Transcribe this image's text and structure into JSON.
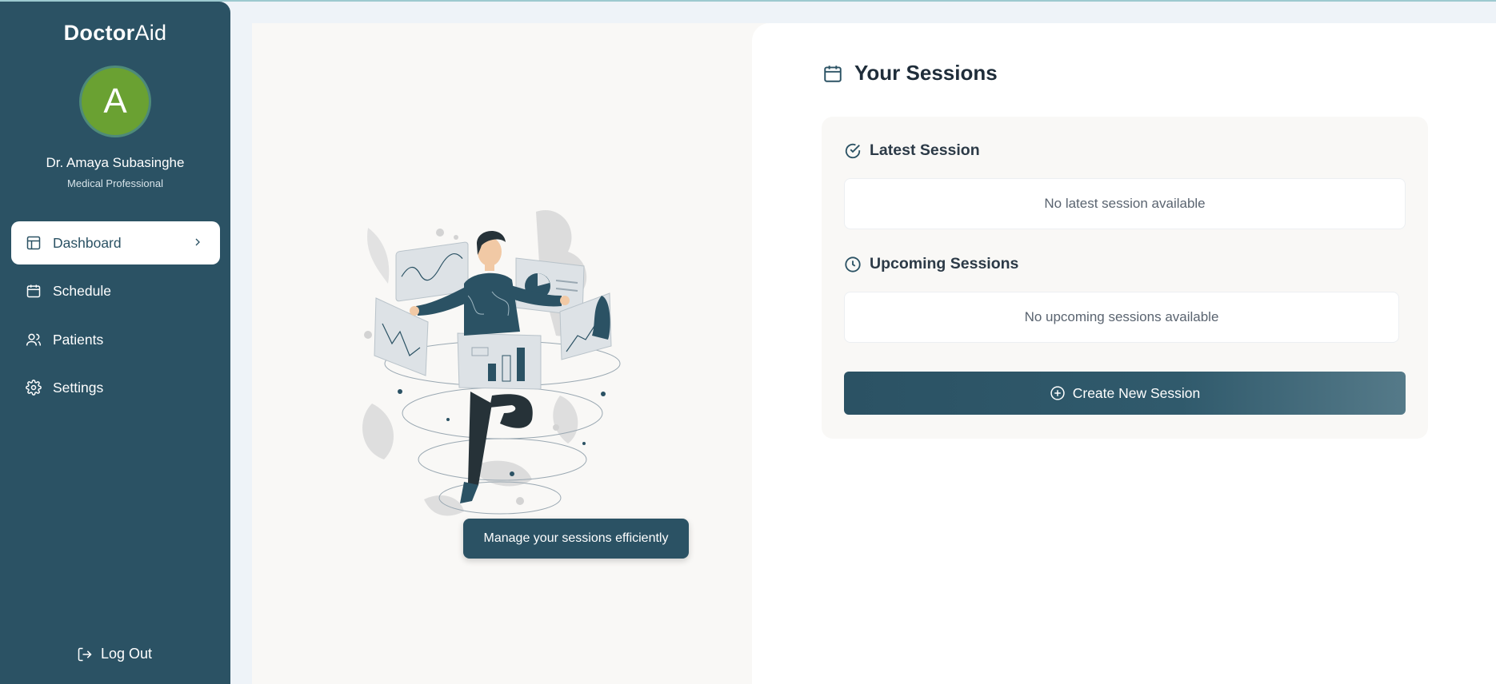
{
  "brand": {
    "logo_bold": "Doctor",
    "logo_light": "Aid"
  },
  "profile": {
    "initial": "A",
    "name": "Dr. Amaya Subasinghe",
    "role": "Medical Professional",
    "avatar_color": "#6aa132"
  },
  "sidebar": {
    "items": [
      {
        "label": "Dashboard",
        "icon": "layout-icon",
        "active": true
      },
      {
        "label": "Schedule",
        "icon": "calendar-icon",
        "active": false
      },
      {
        "label": "Patients",
        "icon": "users-icon",
        "active": false
      },
      {
        "label": "Settings",
        "icon": "gear-icon",
        "active": false
      }
    ],
    "logout_label": "Log Out"
  },
  "illustration": {
    "tooltip": "Manage your sessions efficiently"
  },
  "sessions": {
    "title": "Your Sessions",
    "latest": {
      "heading": "Latest Session",
      "empty_text": "No latest session available"
    },
    "upcoming": {
      "heading": "Upcoming Sessions",
      "empty_text": "No upcoming sessions available"
    },
    "create_label": "Create New Session"
  },
  "colors": {
    "primary": "#2b5264",
    "background": "#eef3f8",
    "panel": "#f9f8f6"
  }
}
